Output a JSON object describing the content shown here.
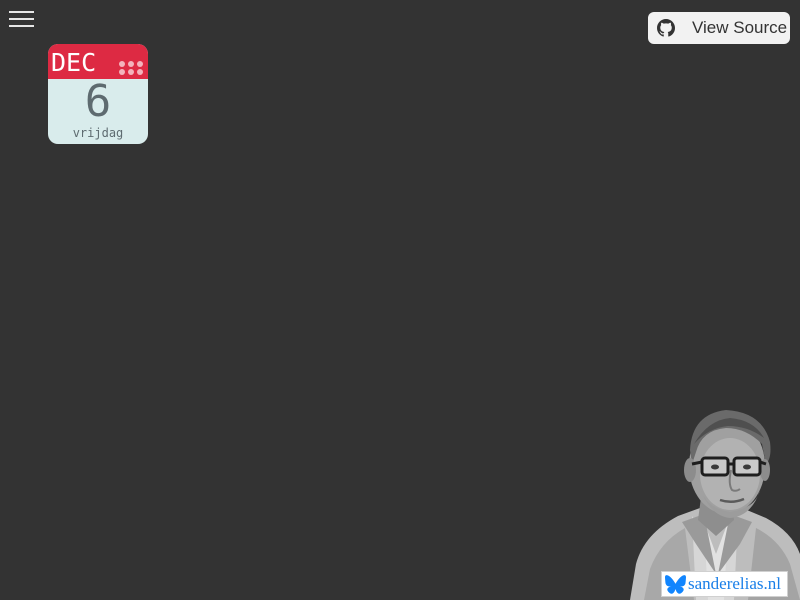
{
  "header": {
    "menu_icon": "hamburger-menu-icon",
    "view_source_label": "View Source",
    "view_source_icon": "github-icon"
  },
  "calendar": {
    "month": "DEC",
    "day": "6",
    "weekday": "vrijdag",
    "header_color": "#dd2a43",
    "body_color": "#d9ecec",
    "icon": "grid-dots-icon"
  },
  "footer": {
    "portrait_icon": "author-portrait",
    "bluesky_icon": "bluesky-butterfly-icon",
    "bluesky_label": "sanderelias.nl",
    "link_color": "#1a7fe8"
  },
  "colors": {
    "background": "#333333",
    "button_bg": "#f2f2f2"
  }
}
